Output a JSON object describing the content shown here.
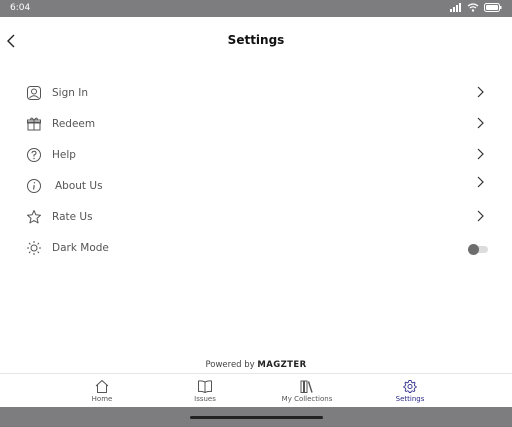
{
  "status_bar": {
    "time": "6:04"
  },
  "header": {
    "title": "Settings"
  },
  "settings": {
    "items": [
      {
        "label": "Sign In",
        "icon": "user-icon"
      },
      {
        "label": "Redeem",
        "icon": "gift-icon"
      },
      {
        "label": "Help",
        "icon": "help-icon"
      },
      {
        "label": "About Us",
        "icon": "info-icon"
      },
      {
        "label": "Rate Us",
        "icon": "star-icon"
      }
    ],
    "dark_mode": {
      "label": "Dark Mode",
      "icon": "sun-icon",
      "enabled": false
    }
  },
  "footer": {
    "powered_prefix": "Powered by",
    "brand": "MAGZTER"
  },
  "tabs": [
    {
      "label": "Home",
      "icon": "home-icon",
      "active": false
    },
    {
      "label": "Issues",
      "icon": "book-icon",
      "active": false
    },
    {
      "label": "My Collections",
      "icon": "library-icon",
      "active": false
    },
    {
      "label": "Settings",
      "icon": "gear-icon",
      "active": true
    }
  ],
  "colors": {
    "accent": "#2a2a8a",
    "system_bar": "#7d7d80"
  }
}
